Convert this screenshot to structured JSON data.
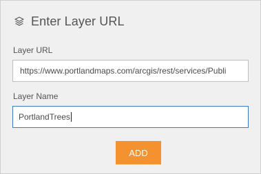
{
  "header": {
    "icon": "layers-icon",
    "title": "Enter Layer URL"
  },
  "form": {
    "url_label": "Layer URL",
    "url_value": "https://www.portlandmaps.com/arcgis/rest/services/Publi",
    "name_label": "Layer Name",
    "name_value": "PortlandTrees"
  },
  "actions": {
    "add_label": "ADD"
  },
  "colors": {
    "panel_bg": "#f0f0f0",
    "accent_orange": "#f4922f",
    "focus_border": "#3a78c6"
  }
}
